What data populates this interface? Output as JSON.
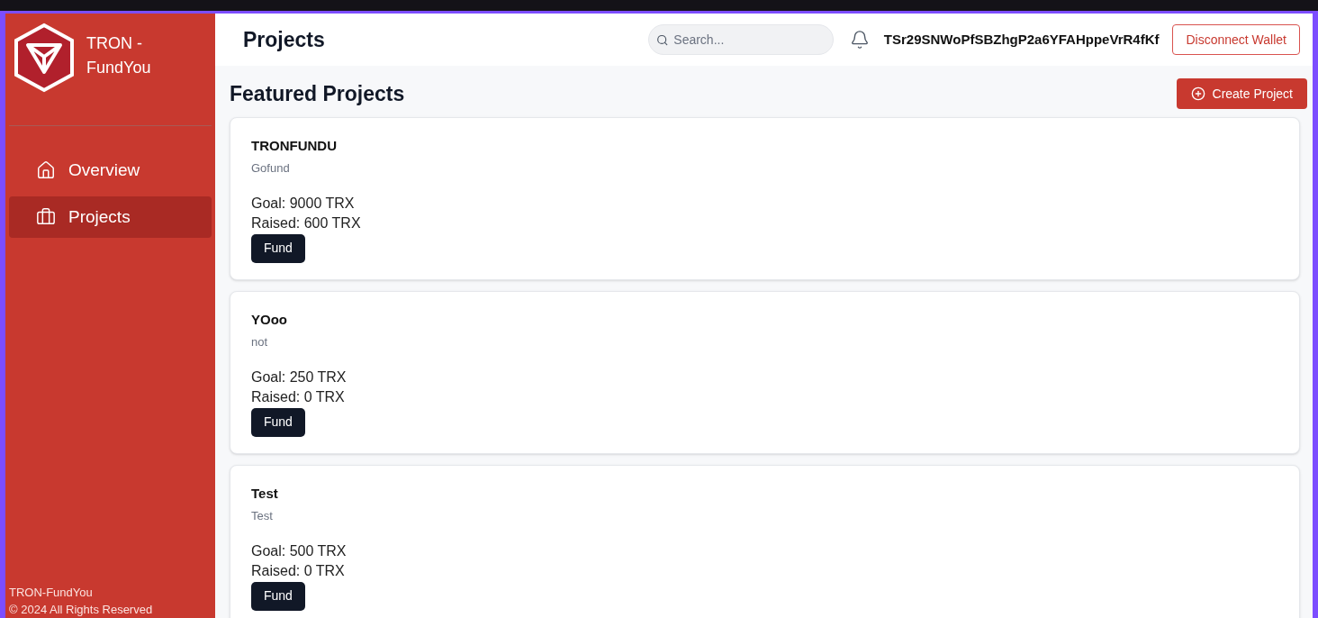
{
  "sidebar": {
    "brand": "TRON - FundYou",
    "items": [
      {
        "label": "Overview",
        "selected": false
      },
      {
        "label": "Projects",
        "selected": true
      }
    ],
    "footer": [
      "TRON-FundYou",
      "© 2024 All Rights Reserved"
    ]
  },
  "header": {
    "title": "Projects",
    "search": {
      "placeholder": "Search..."
    },
    "wallet_address": "TSr29SNWoPfSBZhgP2a6YFAHppeVrR4fKf",
    "disconnect_button": "Disconnect Wallet"
  },
  "section": {
    "title": "Featured Projects",
    "create_button": "Create Project"
  },
  "projects": [
    {
      "name": "TRONFUNDU",
      "description": "Gofund",
      "goal": "Goal: 9000 TRX",
      "raised": "Raised: 600 TRX",
      "button": "Fund"
    },
    {
      "name": "YOoo",
      "description": "not",
      "goal": "Goal: 250 TRX",
      "raised": "Raised: 0 TRX",
      "button": "Fund"
    },
    {
      "name": "Test",
      "description": "Test",
      "goal": "Goal: 500 TRX",
      "raised": "Raised: 0 TRX",
      "button": "Fund"
    }
  ]
}
